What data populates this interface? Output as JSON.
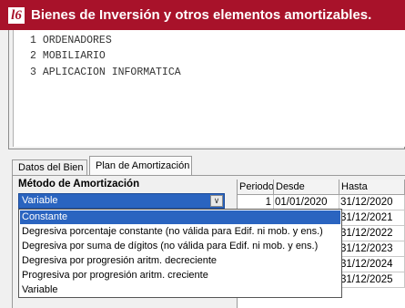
{
  "window": {
    "title": "Bienes de Inversión y otros elementos amortizables.",
    "logo_text": "l6",
    "accent": "#a8122a"
  },
  "elements_list": [
    {
      "number": "1",
      "name": "ORDENADORES"
    },
    {
      "number": "2",
      "name": "MOBILIARIO"
    },
    {
      "number": "3",
      "name": "APLICACION INFORMATICA"
    }
  ],
  "tabs": [
    {
      "label": "Datos del Bien",
      "active": false
    },
    {
      "label": "Plan de Amortización",
      "active": true
    }
  ],
  "metodo": {
    "label": "Método de Amortización",
    "selected": "Variable",
    "options": [
      "Constante",
      "Degresiva porcentaje constante (no válida para Edif. ni mob. y ens.)",
      "Degresiva por suma de dígitos (no válida para Edif. ni mob. y ens.)",
      "Degresiva por progresión aritm. decreciente",
      "Progresiva por progresión aritm. creciente",
      "Variable"
    ],
    "highlighted": "Constante"
  },
  "plan_table": {
    "columns": [
      "Periodo",
      "Desde",
      "Hasta"
    ],
    "rows": [
      {
        "periodo": "1",
        "desde": "01/01/2020",
        "hasta": "31/12/2020"
      },
      {
        "periodo": "",
        "desde": "",
        "hasta": "31/12/2021"
      },
      {
        "periodo": "",
        "desde": "",
        "hasta": "31/12/2022"
      },
      {
        "periodo": "",
        "desde": "",
        "hasta": "31/12/2023"
      },
      {
        "periodo": "",
        "desde": "",
        "hasta": "31/12/2024"
      },
      {
        "periodo": "",
        "desde": "",
        "hasta": "31/12/2025"
      }
    ]
  }
}
